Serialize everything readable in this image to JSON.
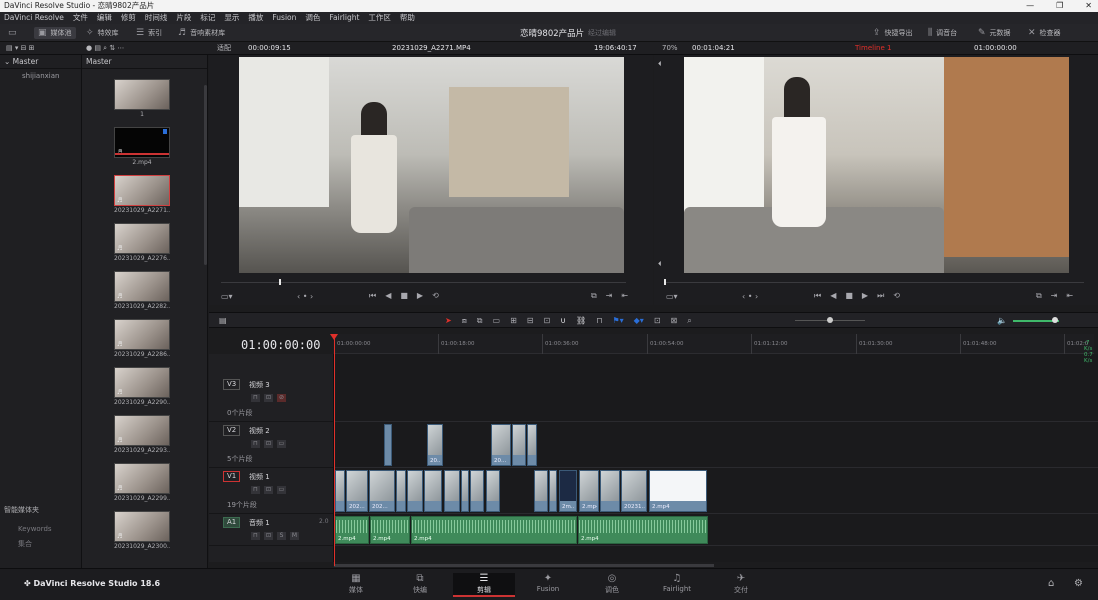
{
  "window": {
    "title": "DaVinci Resolve Studio - 恋晴9802产品片",
    "buttons": [
      "—",
      "❐",
      "✕"
    ]
  },
  "menu": [
    "DaVinci Resolve",
    "文件",
    "编辑",
    "修剪",
    "时间线",
    "片段",
    "标记",
    "显示",
    "播放",
    "Fusion",
    "调色",
    "Fairlight",
    "工作区",
    "帮助"
  ],
  "toolbar": {
    "media_pool": "媒体池",
    "effects": "特效库",
    "index": "索引",
    "sound_library": "音响素材库",
    "project_title": "恋晴9802产品片",
    "project_status": "经过编辑",
    "quick_export": "快捷导出",
    "mixer": "调音台",
    "metadata": "元数据",
    "inspector": "检查器"
  },
  "subbar": {
    "fit": "适配",
    "src_timecode": "00:00:09:15",
    "clip_name": "20231029_A2271.MP4",
    "src_duration": "19:06:40:17",
    "zoom": "70%",
    "rec_duration": "00:01:04:21",
    "timeline_name": "Timeline 1",
    "rec_timecode": "01:00:00:00"
  },
  "left_panel": {
    "master": "Master",
    "bins": [
      "shijianxian"
    ],
    "smart_bins": "智能媒体夹",
    "keywords": "Keywords",
    "collections": "集合"
  },
  "bin": {
    "header": "Master",
    "clips": [
      {
        "name": "1",
        "dark": false,
        "selected": false
      },
      {
        "name": "2.mp4",
        "dark": true,
        "selected": false
      },
      {
        "name": "20231029_A2271....",
        "dark": false,
        "selected": true
      },
      {
        "name": "20231029_A2276....",
        "dark": false,
        "selected": false
      },
      {
        "name": "20231029_A2282....",
        "dark": false,
        "selected": false
      },
      {
        "name": "20231029_A2286....",
        "dark": false,
        "selected": false
      },
      {
        "name": "20231029_A2290....",
        "dark": false,
        "selected": false
      },
      {
        "name": "20231029_A2293....",
        "dark": false,
        "selected": false
      },
      {
        "name": "20231029_A2299....",
        "dark": false,
        "selected": false
      },
      {
        "name": "20231029_A2300....",
        "dark": false,
        "selected": false
      }
    ]
  },
  "timeline": {
    "timecode": "01:00:00:00",
    "ruler": [
      "01:00:00:00",
      "01:00:18:00",
      "01:00:36:00",
      "01:00:54:00",
      "01:01:12:00",
      "01:01:30:00",
      "01:01:48:00",
      "01:02:0"
    ],
    "tracks": [
      {
        "tag": "V3",
        "name": "视频 3",
        "count": "0个片段"
      },
      {
        "tag": "V2",
        "name": "视频 2",
        "count": "5个片段"
      },
      {
        "tag": "V1",
        "name": "视频 1",
        "count": "19个片段"
      },
      {
        "tag": "A1",
        "name": "音频 1",
        "level": "2.0"
      }
    ],
    "v2_clips": [
      "20...",
      "20..."
    ],
    "v1_clips": [
      "202...",
      "202...",
      "2m...",
      "2.mp4",
      "20231...",
      "2.mp4"
    ],
    "a1_clips": [
      "2.mp4",
      "2.mp4",
      "2.mp4",
      "2.mp4"
    ],
    "audio_buttons": [
      "S",
      "M"
    ],
    "meter": [
      "-7",
      "K/s",
      "0.7",
      "K/s"
    ]
  },
  "pages": [
    {
      "label": "媒体",
      "icon": "▦"
    },
    {
      "label": "快编",
      "icon": "⧉"
    },
    {
      "label": "剪辑",
      "icon": "☰"
    },
    {
      "label": "Fusion",
      "icon": "✦"
    },
    {
      "label": "调色",
      "icon": "◎"
    },
    {
      "label": "Fairlight",
      "icon": "♫"
    },
    {
      "label": "交付",
      "icon": "✈"
    }
  ],
  "brand": "DaVinci Resolve Studio 18.6",
  "colors": {
    "accent_red": "#e0302a",
    "clip_blue": "#6d8ba8",
    "audio_green": "#3f8a5a"
  }
}
